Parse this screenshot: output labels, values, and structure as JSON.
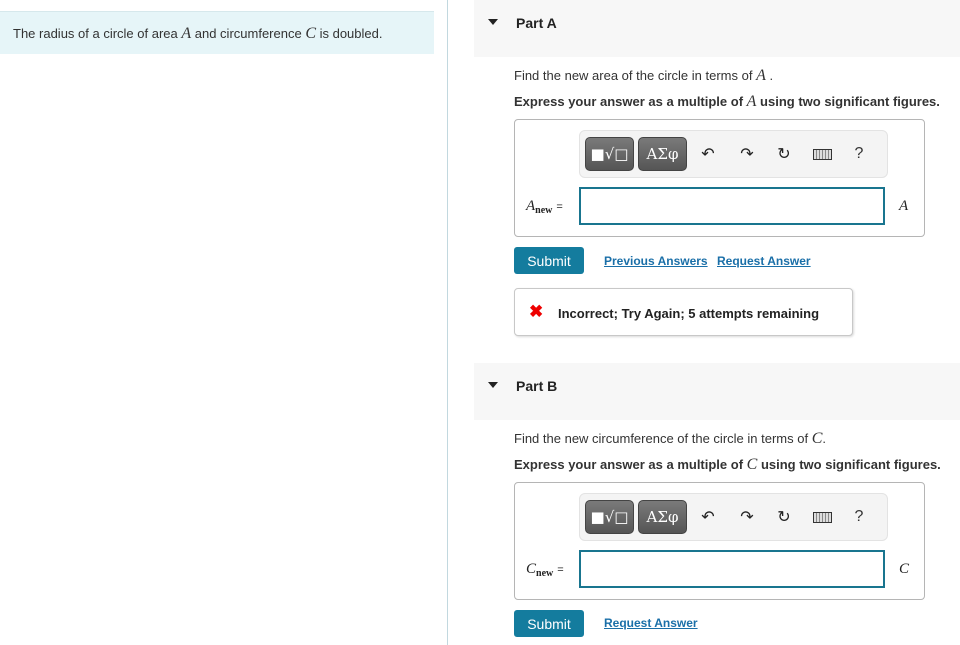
{
  "intro": {
    "text_before": "The radius of a circle of area ",
    "var_a": "A",
    "text_middle": " and circumference ",
    "var_c": "C",
    "text_after": " is doubled."
  },
  "toolbar": {
    "templates_label": "■√□",
    "greek_label": "ΑΣφ",
    "undo_icon": "↶",
    "redo_icon": "↷",
    "reset_icon": "↻",
    "help_label": "?"
  },
  "partA": {
    "title": "Part A",
    "question_before": "Find the new area of the circle in terms of ",
    "question_var": "A",
    "question_after": " .",
    "instruct_before": "Express your answer as a multiple of ",
    "instruct_var": "A",
    "instruct_after": " using two significant figures.",
    "var_main": "A",
    "var_sub": "new",
    "equals": "=",
    "input_value": "",
    "unit": "A",
    "submit_label": "Submit",
    "previous_answers_label": "Previous Answers",
    "request_answer_label": "Request Answer",
    "feedback_icon": "✖",
    "feedback_text": "Incorrect; Try Again; 5 attempts remaining"
  },
  "partB": {
    "title": "Part B",
    "question_before": "Find the new circumference of the circle in terms of ",
    "question_var": "C",
    "question_after": ".",
    "instruct_before": "Express your answer as a multiple of ",
    "instruct_var": "C",
    "instruct_after": " using two significant figures.",
    "var_main": "C",
    "var_sub": "new",
    "equals": "=",
    "input_value": "",
    "unit": "C",
    "submit_label": "Submit",
    "request_answer_label": "Request Answer"
  },
  "colors": {
    "intro_bg": "#e6f5f8",
    "submit_bg": "#147c9e",
    "link": "#1a6fa8",
    "input_border": "#19758f",
    "error": "#ee0000"
  }
}
